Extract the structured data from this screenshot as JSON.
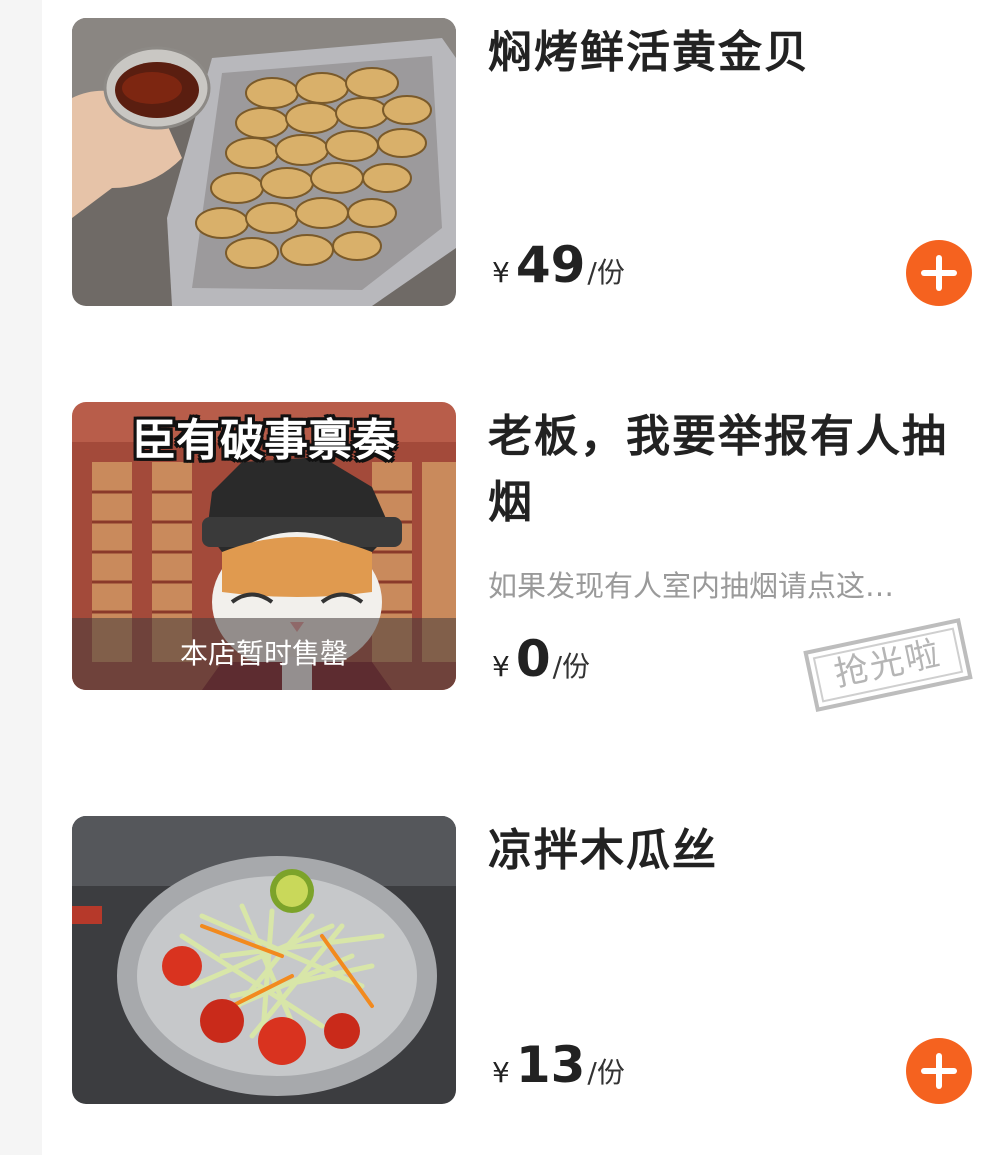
{
  "items": [
    {
      "name": "焖烤鲜活黄金贝",
      "description": "",
      "currency": "¥",
      "price": "49",
      "unit": "/份",
      "sold_out": false
    },
    {
      "name": "老板，我要举报有人抽烟",
      "description": "如果发现有人室内抽烟请点这…",
      "currency": "¥",
      "price": "0",
      "unit": "/份",
      "sold_out": true,
      "image_caption": "臣有破事禀奏",
      "sold_out_label": "本店暂时售罄",
      "stamp_label": "抢光啦"
    },
    {
      "name": "凉拌木瓜丝",
      "description": "",
      "currency": "¥",
      "price": "13",
      "unit": "/份",
      "sold_out": false
    }
  ],
  "colors": {
    "accent": "#f5621f",
    "text": "#222222",
    "muted": "#9a9a9a"
  },
  "icons": {
    "add": "plus-circle-icon"
  }
}
